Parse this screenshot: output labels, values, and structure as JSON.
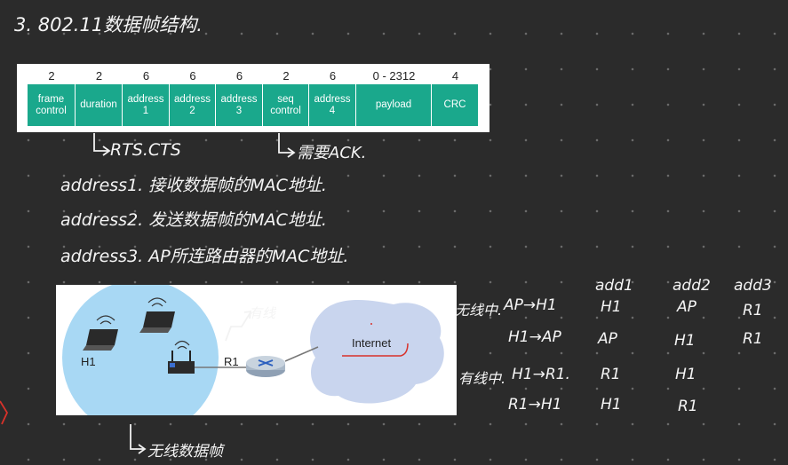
{
  "heading": "3. 802.11数据帧结构.",
  "frame": {
    "fields": [
      {
        "size": "2",
        "name": "frame\ncontrol"
      },
      {
        "size": "2",
        "name": "duration"
      },
      {
        "size": "6",
        "name": "address\n1"
      },
      {
        "size": "6",
        "name": "address\n2"
      },
      {
        "size": "6",
        "name": "address\n3"
      },
      {
        "size": "2",
        "name": "seq\ncontrol"
      },
      {
        "size": "6",
        "name": "address\n4"
      },
      {
        "size": "0 - 2312",
        "name": "payload"
      },
      {
        "size": "4",
        "name": "CRC"
      }
    ]
  },
  "notes": {
    "duration_note": "RTS.CTS",
    "seq_note": "需要ACK.",
    "addr1": "address1. 接收数据帧的MAC地址.",
    "addr2": "address2. 发送数据帧的MAC地址.",
    "addr3": "address3. AP所连路由器的MAC地址.",
    "bottom_note": "无线数据帧",
    "wired_note": "有线"
  },
  "network": {
    "h1_label": "H1",
    "r1_label": "R1",
    "internet_label": "Internet"
  },
  "addr_table": {
    "headers": [
      "add1",
      "add2",
      "add3"
    ],
    "group1_label": "无线中.",
    "group2_label": "有线中.",
    "rows": [
      {
        "direction": "AP→H1",
        "a1": "H1",
        "a2": "AP",
        "a3": "R1"
      },
      {
        "direction": "H1→AP",
        "a1": "AP",
        "a2": "H1",
        "a3": "R1"
      },
      {
        "direction": "H1→R1.",
        "a1": "R1",
        "a2": "H1",
        "a3": ""
      },
      {
        "direction": "R1→H1",
        "a1": "H1",
        "a2": "R1",
        "a3": ""
      }
    ]
  }
}
